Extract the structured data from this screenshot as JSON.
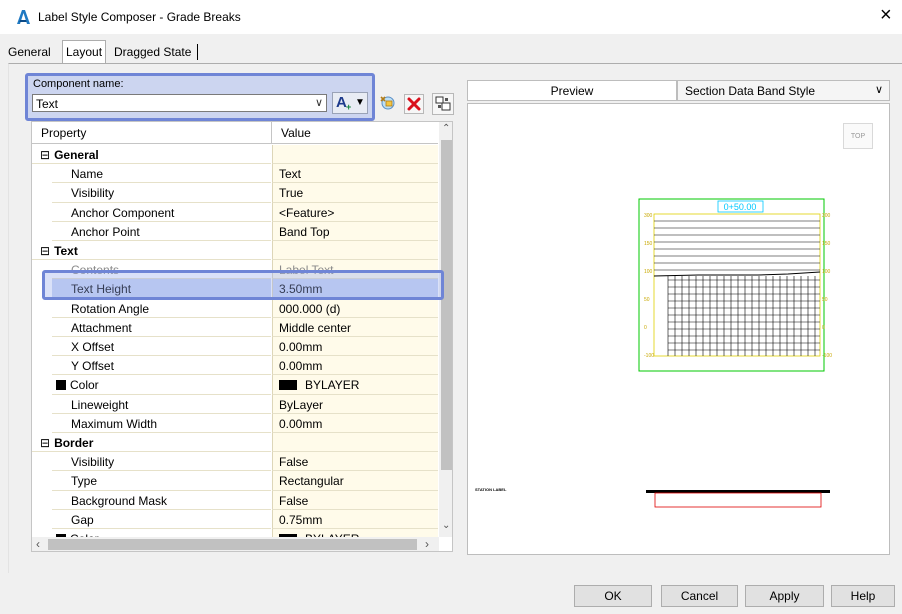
{
  "window": {
    "title": "Label Style Composer - Grade Breaks",
    "close_glyph": "×",
    "icon": "autocad-civil-a-icon"
  },
  "tabs": [
    {
      "label": "General",
      "active": false
    },
    {
      "label": "Layout",
      "active": true
    },
    {
      "label": "Dragged State",
      "active": false
    }
  ],
  "component": {
    "label": "Component name:",
    "value": "Text",
    "add_glyph": "A",
    "add_plus": "+",
    "icons": [
      "add-text-component-icon",
      "copy-component-icon",
      "delete-component-icon",
      "component-draw-order-icon"
    ]
  },
  "grid": {
    "headers": {
      "property": "Property",
      "value": "Value"
    },
    "rows": [
      {
        "type": "cat",
        "expander": "⊟",
        "property": "General",
        "value": ""
      },
      {
        "type": "prop",
        "property": "Name",
        "value": "Text"
      },
      {
        "type": "prop",
        "property": "Visibility",
        "value": "True"
      },
      {
        "type": "prop",
        "property": "Anchor Component",
        "value": "<Feature>"
      },
      {
        "type": "prop",
        "property": "Anchor Point",
        "value": "Band Top"
      },
      {
        "type": "cat",
        "expander": "⊟",
        "property": "Text",
        "value": ""
      },
      {
        "type": "prop",
        "property": "Contents",
        "value": "Label Text",
        "dim": true
      },
      {
        "type": "prop",
        "property": "Text Height",
        "value": "3.50mm",
        "selected": true
      },
      {
        "type": "prop",
        "property": "Rotation Angle",
        "value": "000.000 (d)"
      },
      {
        "type": "prop",
        "property": "Attachment",
        "value": "Middle center"
      },
      {
        "type": "prop",
        "property": "X Offset",
        "value": "0.00mm"
      },
      {
        "type": "prop",
        "property": "Y Offset",
        "value": "0.00mm"
      },
      {
        "type": "prop",
        "property": "Color",
        "value": "BYLAYER",
        "swatch": true
      },
      {
        "type": "prop",
        "property": "Lineweight",
        "value": "ByLayer"
      },
      {
        "type": "prop",
        "property": "Maximum Width",
        "value": "0.00mm"
      },
      {
        "type": "cat",
        "expander": "⊟",
        "property": "Border",
        "value": ""
      },
      {
        "type": "prop",
        "property": "Visibility",
        "value": "False"
      },
      {
        "type": "prop",
        "property": "Type",
        "value": "Rectangular"
      },
      {
        "type": "prop",
        "property": "Background Mask",
        "value": "False"
      },
      {
        "type": "prop",
        "property": "Gap",
        "value": "0.75mm"
      },
      {
        "type": "prop",
        "property": "Color",
        "value": "BYLAYER",
        "swatch": true
      }
    ]
  },
  "preview": {
    "label": "Preview",
    "style_select": "Section Data Band Style",
    "top_button": "TOP",
    "station_label": "0+50.00",
    "left_axis": [
      "300",
      "150",
      "100",
      "50",
      "0",
      "-100",
      "-150"
    ],
    "right_axis": [
      "300",
      "150",
      "100",
      "50",
      "0",
      "-100",
      "-150"
    ],
    "band_title": "STATION LABEL"
  },
  "buttons": {
    "ok": "OK",
    "cancel": "Cancel",
    "apply": "Apply",
    "help": "Help"
  },
  "colors": {
    "highlight": "#6f85d6",
    "grid_value_bg": "#fffbea",
    "selected_row": "#c9d6f5",
    "preview_frame": "#00c800",
    "preview_title": "#00c8ff",
    "band_outline": "#e00000"
  }
}
